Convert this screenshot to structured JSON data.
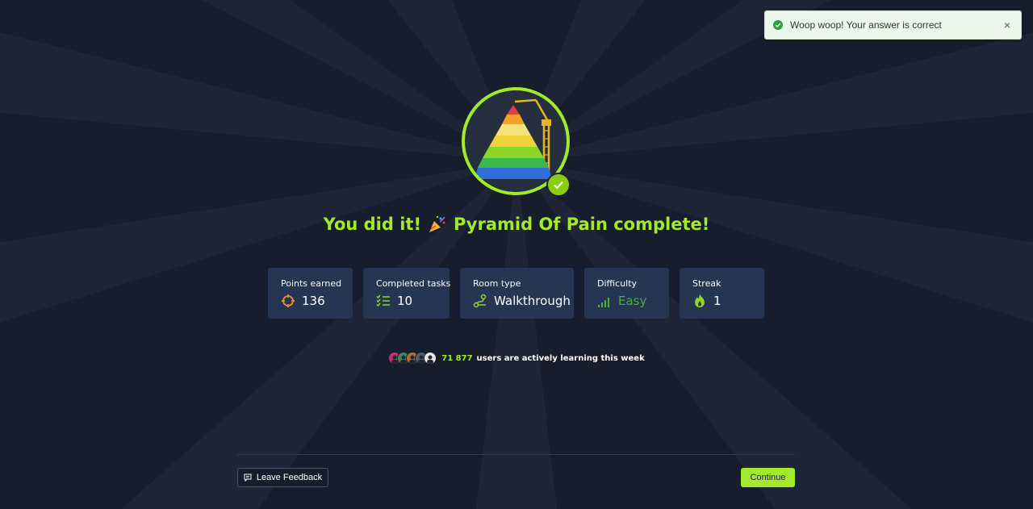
{
  "toast": {
    "message": "Woop woop! Your answer is correct",
    "close_label": "×"
  },
  "headline": {
    "prefix": "You did it!",
    "suffix": "Pyramid Of Pain complete!"
  },
  "stats": [
    {
      "label": "Points earned",
      "value": "136",
      "icon": "crosshair-icon"
    },
    {
      "label": "Completed tasks",
      "value": "10",
      "icon": "checklist-icon"
    },
    {
      "label": "Room type",
      "value": "Walkthrough",
      "icon": "route-icon"
    },
    {
      "label": "Difficulty",
      "value": "Easy",
      "icon": "signal-bars-icon"
    },
    {
      "label": "Streak",
      "value": "1",
      "icon": "flame-icon"
    }
  ],
  "users": {
    "count": "71 877",
    "text": "users are actively learning this week"
  },
  "buttons": {
    "feedback": "Leave Feedback",
    "continue": "Continue"
  },
  "colors": {
    "background": "#161d2c",
    "accent": "#a3ea2a",
    "card": "#253552",
    "easy": "#4caf3c",
    "toast_bg": "#ecf7ec"
  }
}
